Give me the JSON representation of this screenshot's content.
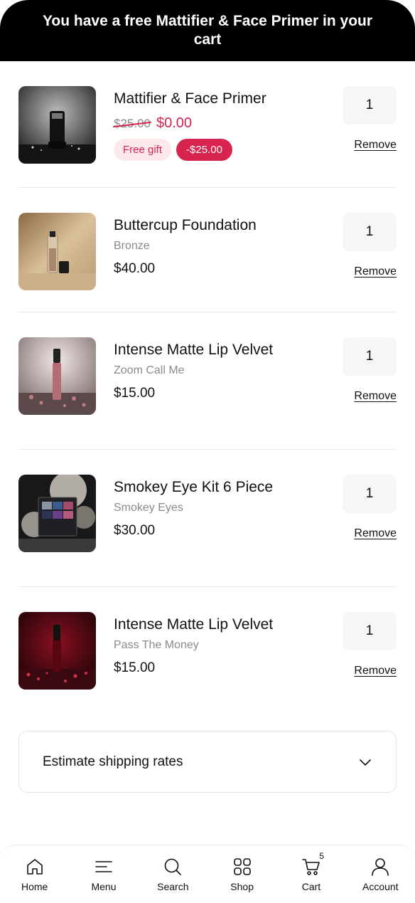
{
  "banner": {
    "text": "You have a free Mattifier & Face Primer in your cart"
  },
  "cart": {
    "items": [
      {
        "title": "Mattifier & Face Primer",
        "old_price": "$25.00",
        "price": "$0.00",
        "badge_gift": "Free gift",
        "badge_discount": "-$25.00",
        "qty": "1",
        "remove": "Remove"
      },
      {
        "title": "Buttercup Foundation",
        "variant": "Bronze",
        "price": "$40.00",
        "qty": "1",
        "remove": "Remove"
      },
      {
        "title": "Intense Matte Lip Velvet",
        "variant": "Zoom Call Me",
        "price": "$15.00",
        "qty": "1",
        "remove": "Remove"
      },
      {
        "title": "Smokey Eye Kit 6 Piece",
        "variant": "Smokey Eyes",
        "price": "$30.00",
        "qty": "1",
        "remove": "Remove"
      },
      {
        "title": "Intense Matte Lip Velvet",
        "variant": "Pass The Money",
        "price": "$15.00",
        "qty": "1",
        "remove": "Remove"
      }
    ]
  },
  "shipping": {
    "label": "Estimate shipping rates",
    "icon": "chevron-down-icon"
  },
  "tabbar": {
    "tabs": [
      {
        "label": "Home",
        "icon": "home-icon"
      },
      {
        "label": "Menu",
        "icon": "menu-icon"
      },
      {
        "label": "Search",
        "icon": "search-icon"
      },
      {
        "label": "Shop",
        "icon": "grid-icon"
      },
      {
        "label": "Cart",
        "icon": "cart-icon",
        "count": "5"
      },
      {
        "label": "Account",
        "icon": "user-icon"
      }
    ]
  },
  "colors": {
    "accent": "#d6244f",
    "banner_bg": "#000000"
  }
}
